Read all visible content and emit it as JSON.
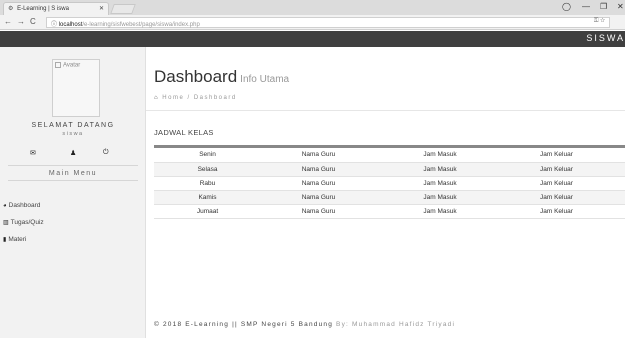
{
  "browser": {
    "tab_title": "E-Learning | S iswa",
    "tab_close": "✕",
    "url_host": "localhost",
    "url_path": "/e-learning/sisfwebest/page/siswa/index.php",
    "win_min": "—",
    "win_max": "❐",
    "win_close": "✕"
  },
  "header": {
    "brand": "SISWA"
  },
  "sidebar": {
    "avatar_alt": "Avatar",
    "welcome": "SELAMAT DATANG",
    "role": "siswa",
    "menu_title": "Main Menu",
    "items": [
      {
        "label": "Dashboard",
        "icon": "dashboard-icon"
      },
      {
        "label": "Tugas/Quiz",
        "icon": "bar-chart-icon"
      },
      {
        "label": "Materi",
        "icon": "file-icon"
      }
    ]
  },
  "main": {
    "title": "Dashboard",
    "subtitle": "Info Utama",
    "breadcrumb_home": "Home",
    "breadcrumb_sep": "/",
    "breadcrumb_current": "Dashboard",
    "section_title": "JADWAL KELAS",
    "schedule": [
      {
        "day": "Senin",
        "teacher": "Nama Guru",
        "in": "Jam Masuk",
        "out": "Jam Keluar"
      },
      {
        "day": "Selasa",
        "teacher": "Nama Guru",
        "in": "Jam Masuk",
        "out": "Jam Keluar"
      },
      {
        "day": "Rabu",
        "teacher": "Nama Guru",
        "in": "Jam Masuk",
        "out": "Jam Keluar"
      },
      {
        "day": "Kamis",
        "teacher": "Nama Guru",
        "in": "Jam Masuk",
        "out": "Jam Keluar"
      },
      {
        "day": "Jumaat",
        "teacher": "Nama Guru",
        "in": "Jam Masuk",
        "out": "Jam Keluar"
      }
    ]
  },
  "footer": {
    "text": "© 2018 E-Learning || SMP Negeri 5 Bandung",
    "by": "By: Muhammad Hafidz Triyadi"
  },
  "colors": {
    "topnav": "#3f3f3f",
    "sidebar": "#f2f2f2",
    "table_rule": "#888888"
  }
}
